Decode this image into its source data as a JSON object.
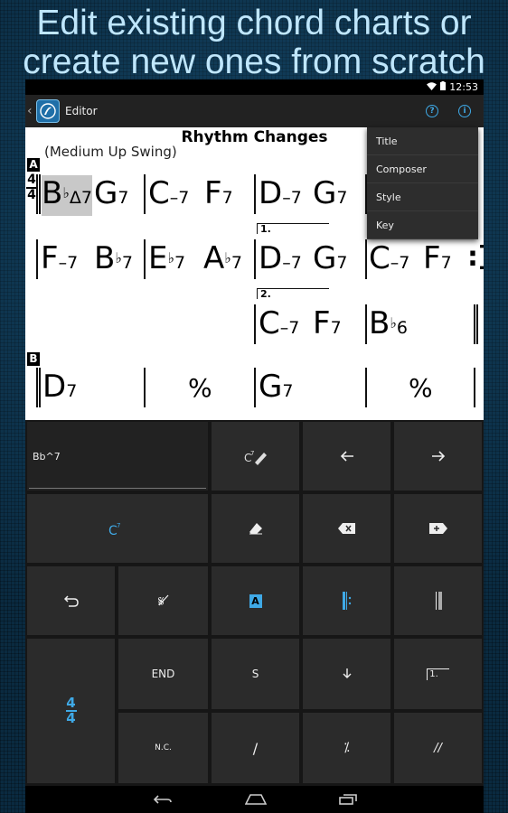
{
  "promo": {
    "line1": "Edit existing chord charts or",
    "line2": "create new ones from scratch"
  },
  "status_bar": {
    "time": "12:53"
  },
  "action_bar": {
    "title": "Editor",
    "help_icon": "question-circle-icon",
    "info_icon": "info-circle-icon",
    "accent": "#3fa9e6"
  },
  "chart": {
    "title": "Rhythm Changes",
    "style": "(Medium Up Swing)",
    "sections": [
      "A",
      "B"
    ],
    "time_signature": {
      "top": "4",
      "bottom": "4"
    },
    "endings": [
      "1.",
      "2."
    ],
    "rows": [
      {
        "chords": [
          {
            "root": "B",
            "acc": "b",
            "qual": "Δ7"
          },
          {
            "root": "G",
            "acc": "",
            "qual": "7"
          },
          {
            "root": "C",
            "acc": "",
            "qual": "–7"
          },
          {
            "root": "F",
            "acc": "",
            "qual": "7"
          },
          {
            "root": "D",
            "acc": "",
            "qual": "–7"
          },
          {
            "root": "G",
            "acc": "",
            "qual": "7"
          }
        ]
      },
      {
        "chords": [
          {
            "root": "F",
            "acc": "",
            "qual": "–7"
          },
          {
            "root": "B",
            "acc": "b",
            "qual": "7"
          },
          {
            "root": "E",
            "acc": "b",
            "qual": "7"
          },
          {
            "root": "A",
            "acc": "b",
            "qual": "7"
          },
          {
            "root": "D",
            "acc": "",
            "qual": "–7"
          },
          {
            "root": "G",
            "acc": "",
            "qual": "7"
          },
          {
            "root": "C",
            "acc": "",
            "qual": "–7"
          },
          {
            "root": "F",
            "acc": "",
            "qual": "7"
          }
        ]
      },
      {
        "chords": [
          {
            "root": "C",
            "acc": "",
            "qual": "–7"
          },
          {
            "root": "F",
            "acc": "",
            "qual": "7"
          },
          {
            "root": "B",
            "acc": "b",
            "qual": "6"
          }
        ]
      },
      {
        "chords": [
          {
            "root": "D",
            "acc": "",
            "qual": "7"
          },
          {
            "root": "G",
            "acc": "",
            "qual": "7"
          }
        ],
        "simile": "%"
      }
    ]
  },
  "menu": {
    "items": [
      "Title",
      "Composer",
      "Style",
      "Key"
    ]
  },
  "keyboard": {
    "input_value": "Bb^7",
    "end_label": "END",
    "segno_label": "S",
    "nc_label": "N.C.",
    "slash_label": "/",
    "simile_label": "⁒",
    "double_simile_label": "//",
    "time_sig_top": "4",
    "time_sig_bottom": "4",
    "rehearsal_label": "A",
    "ending_label": "1."
  }
}
